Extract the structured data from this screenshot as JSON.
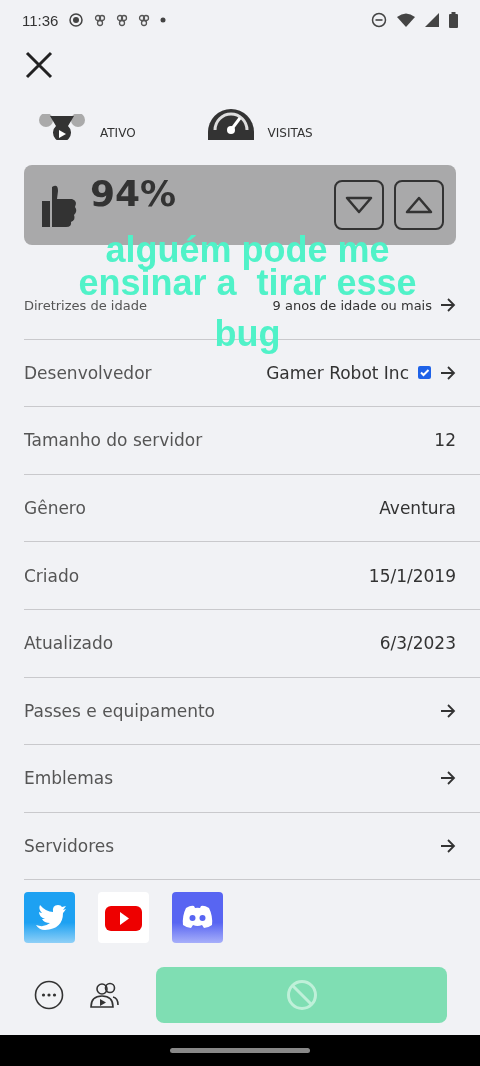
{
  "status_bar": {
    "time": "11:36"
  },
  "stats": [
    {
      "kind": "players",
      "label": "ATIVO"
    },
    {
      "kind": "visits",
      "label": "VISITAS"
    }
  ],
  "rating": {
    "percent": "94%"
  },
  "rows": [
    {
      "label": "Diretrizes de idade",
      "value": "9 anos de idade ou mais",
      "arrow": true,
      "verified": false
    },
    {
      "label": "Desenvolvedor",
      "value": "Gamer Robot Inc",
      "arrow": true,
      "verified": true
    },
    {
      "label": "Tamanho do servidor",
      "value": "12",
      "arrow": false,
      "verified": false
    },
    {
      "label": "Gênero",
      "value": "Aventura",
      "arrow": false,
      "verified": false
    },
    {
      "label": "Criado",
      "value": "15/1/2019",
      "arrow": false,
      "verified": false
    },
    {
      "label": "Atualizado",
      "value": "6/3/2023",
      "arrow": false,
      "verified": false
    },
    {
      "label": "Passes e equipamento",
      "arrow": true,
      "verified": false
    },
    {
      "label": "Emblemas",
      "arrow": true,
      "verified": false
    },
    {
      "label": "Servidores",
      "arrow": true,
      "verified": false
    }
  ],
  "social": [
    {
      "kind": "twitter"
    },
    {
      "kind": "youtube"
    },
    {
      "kind": "discord"
    }
  ],
  "play_button": {
    "disabled": true
  },
  "caption_lines": [
    "alguém pode me",
    "ensinar a  tirar esse",
    "bug"
  ]
}
